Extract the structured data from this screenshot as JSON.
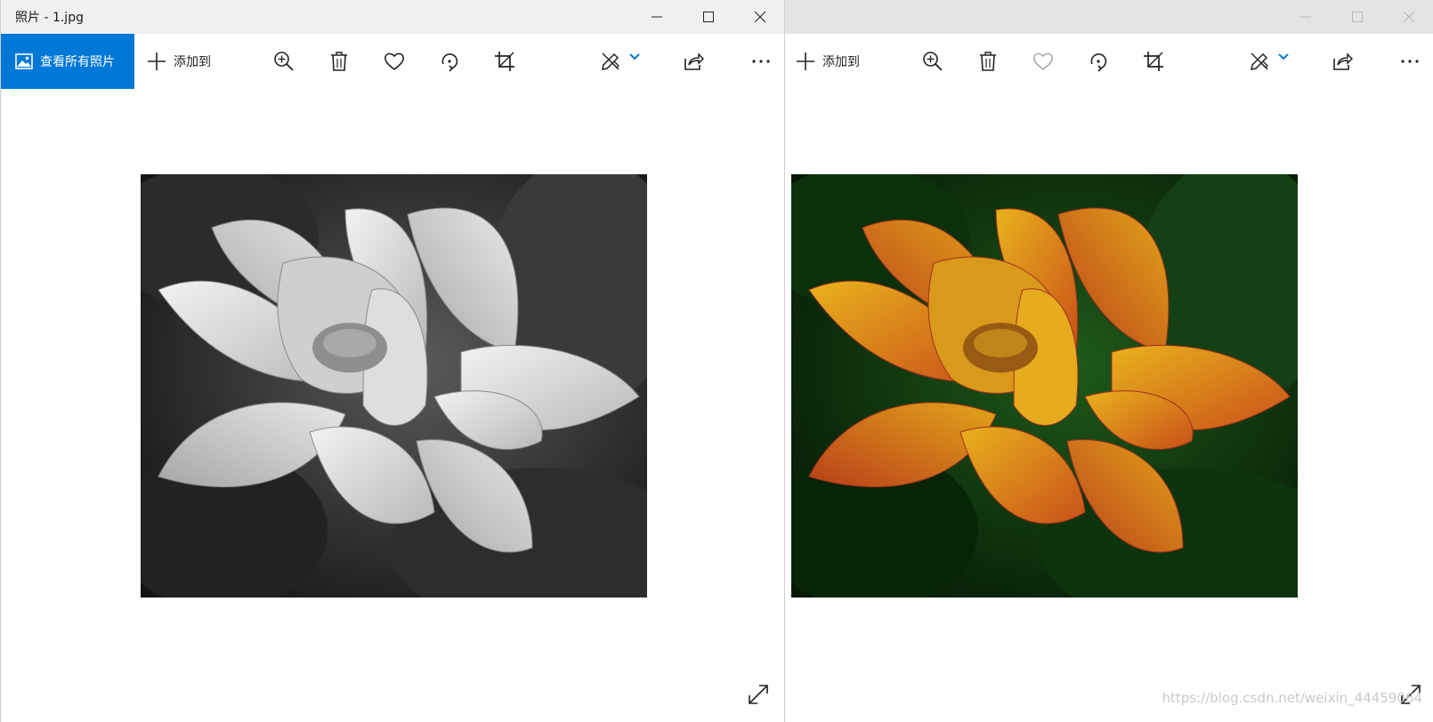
{
  "left_window": {
    "title": "照片 - 1.jpg",
    "toolbar": {
      "view_all_label": "查看所有照片",
      "add_to_label": "添加到"
    }
  },
  "right_window": {
    "toolbar": {
      "add_to_label": "添加到"
    }
  },
  "watermark": "https://blog.csdn.net/weixin_44459064",
  "icons": [
    "picture-icon",
    "plus-icon",
    "zoom-in-icon",
    "trash-icon",
    "heart-icon",
    "rotate-icon",
    "crop-icon",
    "edit-draw-icon",
    "chevron-down-icon",
    "share-icon",
    "more-icon",
    "expand-icon",
    "minimize-icon",
    "maximize-icon",
    "close-icon"
  ],
  "colors": {
    "accent": "#0078d7",
    "left_photo_tone": "grayscale",
    "right_photo_tone": "orange-on-green"
  }
}
